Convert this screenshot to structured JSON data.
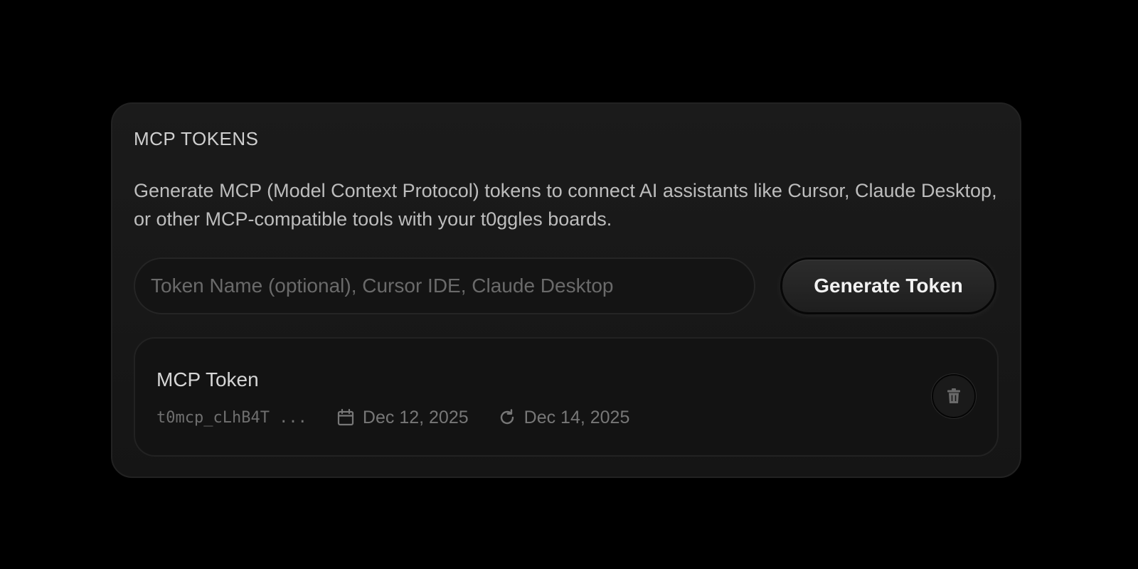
{
  "panel": {
    "title": "MCP TOKENS",
    "description": "Generate MCP (Model Context Protocol) tokens to connect AI assistants like Cursor, Claude Desktop, or other MCP-compatible tools with your t0ggles boards."
  },
  "form": {
    "token_name_placeholder": "Token Name (optional), Cursor IDE, Claude Desktop",
    "token_name_value": "",
    "generate_label": "Generate Token"
  },
  "tokens": [
    {
      "name": "MCP Token",
      "token_preview": "t0mcp_cLhB4T ...",
      "created": "Dec 12, 2025",
      "last_used": "Dec 14, 2025",
      "created_icon": "calendar-icon",
      "last_used_icon": "refresh-icon",
      "delete_icon": "trash-icon"
    }
  ],
  "colors": {
    "background": "#000000",
    "panel": "#181818",
    "text_primary": "#d6d6d6",
    "text_muted": "#777777"
  }
}
